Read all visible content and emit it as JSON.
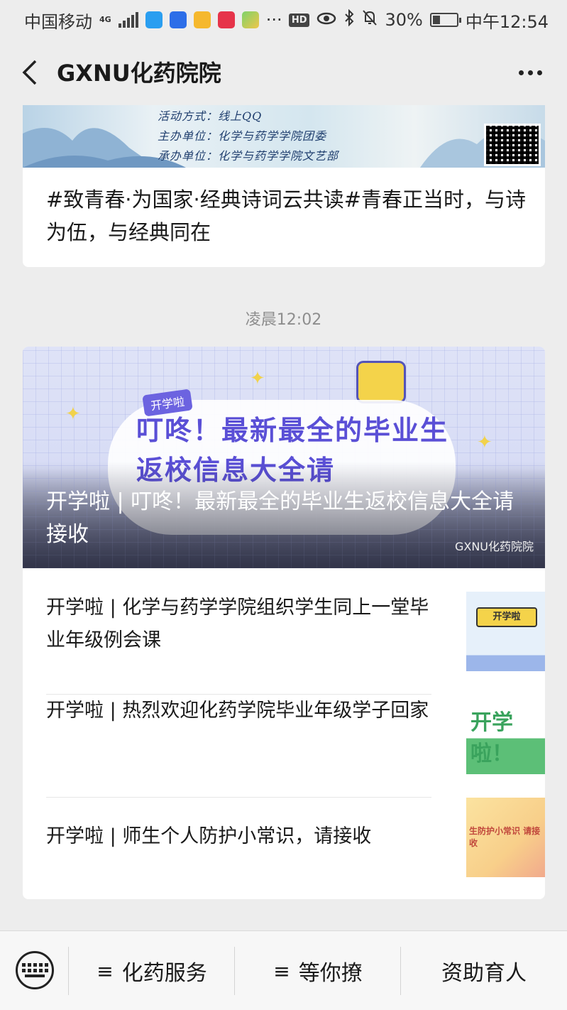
{
  "status_bar": {
    "carrier": "中国移动",
    "network": "4G",
    "battery": "30%",
    "battery_level": 0.3,
    "time": "中午12:54",
    "hd_label": "HD",
    "more_dots": "···"
  },
  "nav": {
    "title": "GXNU化药院院"
  },
  "article1": {
    "banner_lines": [
      "活动方式：线上QQ",
      "主办单位：化学与药学学院团委",
      "承办单位：化学与药学学院文艺部"
    ],
    "title": "#致青春·为国家·经典诗词云共读#青春正当时，与诗为伍，与经典同在"
  },
  "timestamp": "凌晨12:02",
  "article2": {
    "hero_tag": "开学啦",
    "hero_poster_text": "叮咚！最新最全的毕业生返校信息大全请",
    "hero_title": "开学啦 | 叮咚！最新最全的毕业生返校信息大全请接收",
    "watermark": "GXNU化药院院",
    "sub_articles": [
      {
        "title": "开学啦 | 化学与药学学院组织学生同上一堂毕业年级例会课",
        "thumb_label": "开学啦"
      },
      {
        "title": "开学啦 | 热烈欢迎化药学院毕业年级学子回家",
        "thumb_label": "开学啦！"
      },
      {
        "title": "开学啦 | 师生个人防护小常识，请接收",
        "thumb_label": "生防护小常识 请接收"
      }
    ]
  },
  "bottom_menu": {
    "items": [
      {
        "label": "化药服务",
        "prefix": "≡"
      },
      {
        "label": "等你撩",
        "prefix": "≡"
      },
      {
        "label": "资助育人",
        "prefix": ""
      }
    ]
  }
}
